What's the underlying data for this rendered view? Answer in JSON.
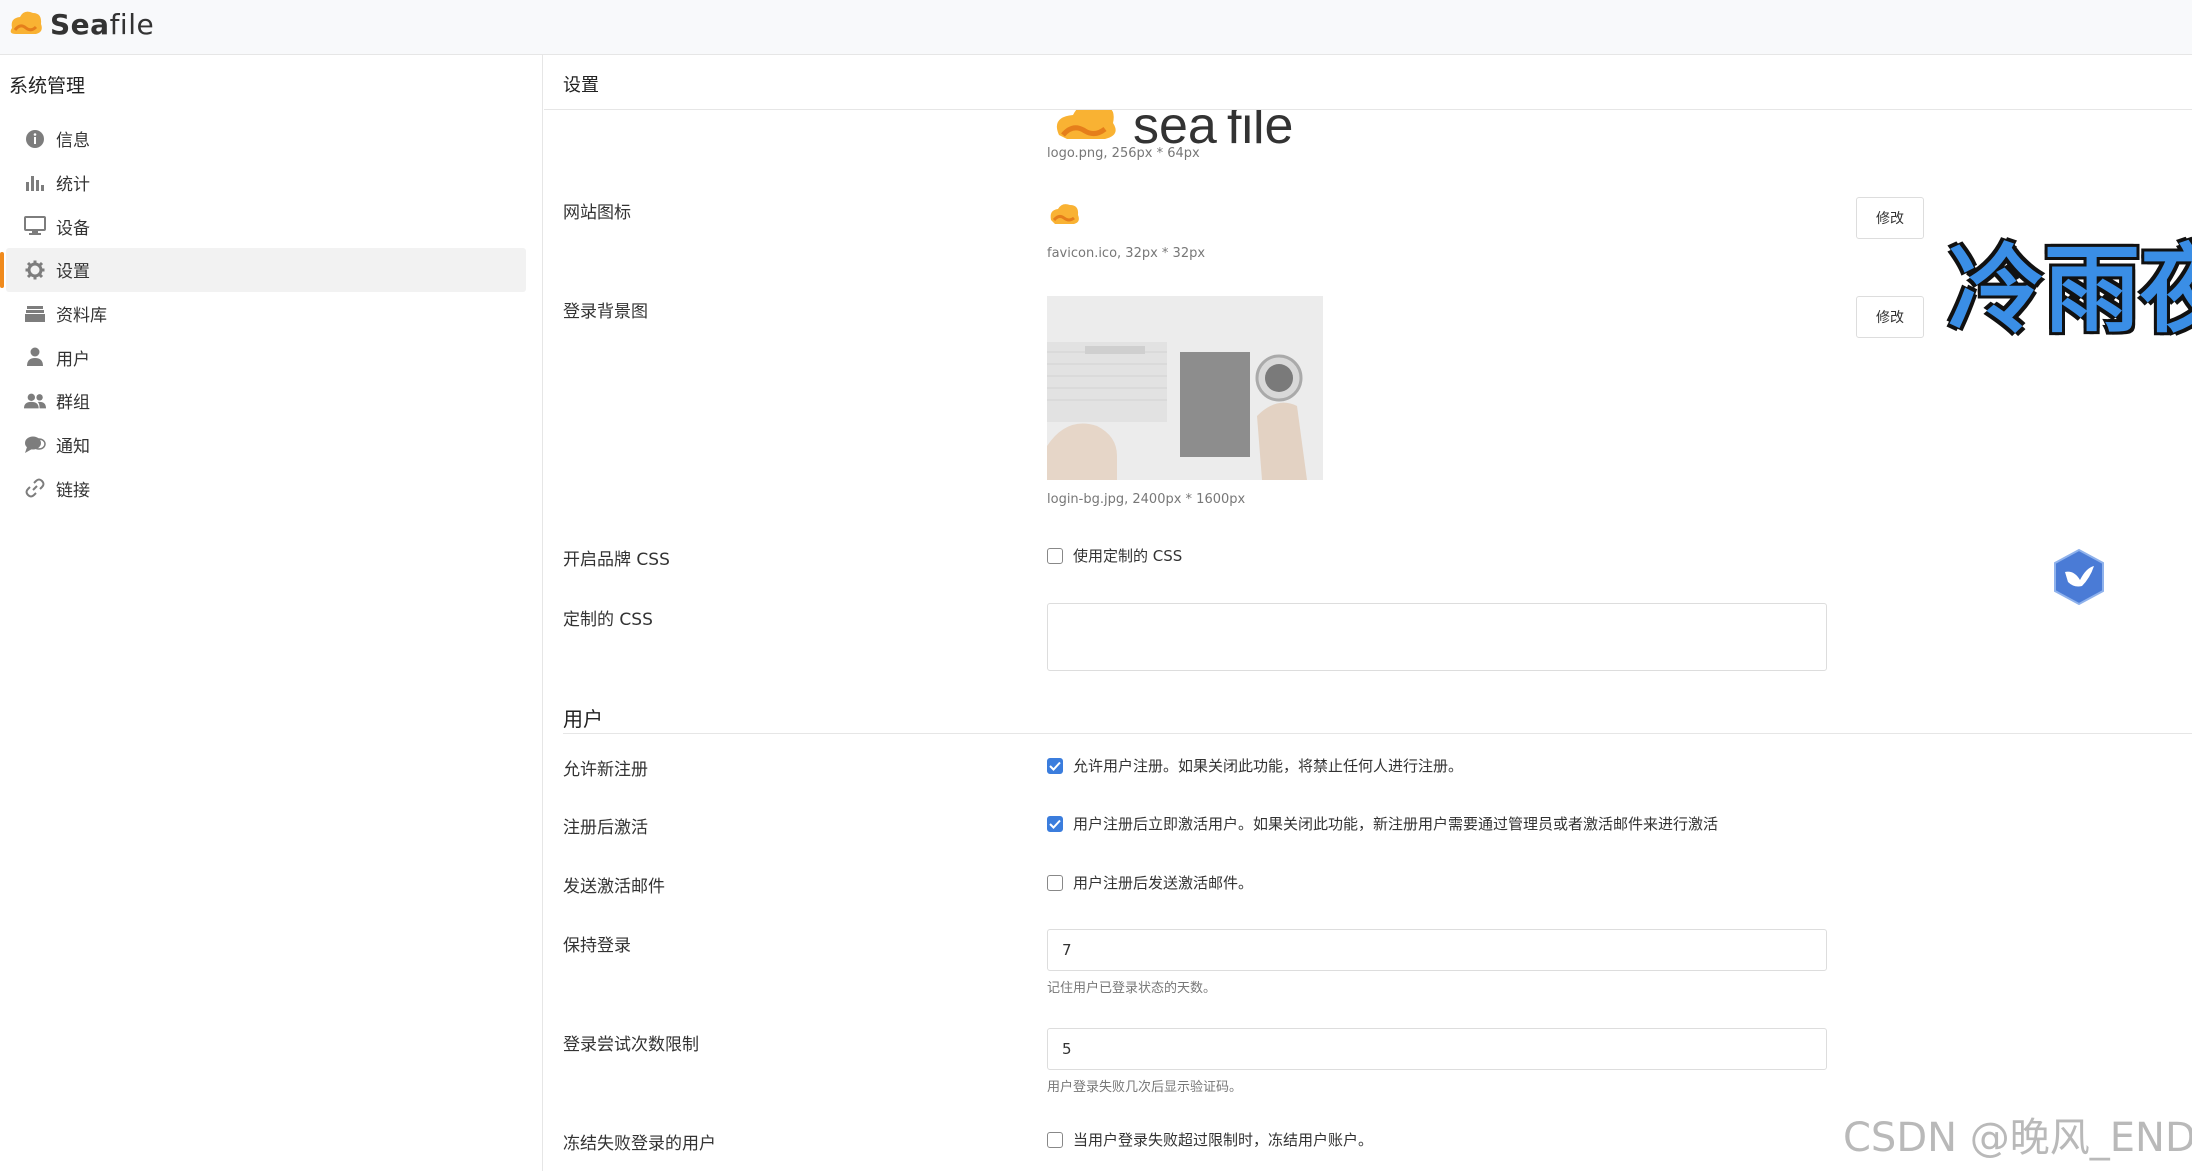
{
  "brand": {
    "name_part1": "Sea",
    "name_part2": "file"
  },
  "sidebar": {
    "title": "系统管理",
    "items": [
      {
        "label": "信息",
        "icon": "info-icon"
      },
      {
        "label": "统计",
        "icon": "bar-chart-icon"
      },
      {
        "label": "设备",
        "icon": "monitor-icon"
      },
      {
        "label": "设置",
        "icon": "gear-icon",
        "active": true
      },
      {
        "label": "资料库",
        "icon": "library-icon"
      },
      {
        "label": "用户",
        "icon": "user-icon"
      },
      {
        "label": "群组",
        "icon": "group-icon"
      },
      {
        "label": "通知",
        "icon": "chat-icon"
      },
      {
        "label": "链接",
        "icon": "link-icon"
      }
    ]
  },
  "main": {
    "title": "设置",
    "logo": {
      "hint": "logo.png, 256px * 64px"
    },
    "favicon": {
      "label": "网站图标",
      "hint": "favicon.ico, 32px * 32px",
      "button": "修改"
    },
    "login_bg": {
      "label": "登录背景图",
      "hint": "login-bg.jpg, 2400px * 1600px",
      "button": "修改"
    },
    "brand_css": {
      "label": "开启品牌 CSS",
      "checkbox_label": "使用定制的 CSS",
      "checked": false
    },
    "custom_css": {
      "label": "定制的 CSS",
      "value": ""
    },
    "users_section": {
      "title": "用户",
      "allow_register": {
        "label": "允许新注册",
        "checkbox_label": "允许用户注册。如果关闭此功能，将禁止任何人进行注册。",
        "checked": true
      },
      "activate_after_register": {
        "label": "注册后激活",
        "checkbox_label": "用户注册后立即激活用户。如果关闭此功能，新注册用户需要通过管理员或者激活邮件来进行激活",
        "checked": true
      },
      "send_activation_email": {
        "label": "发送激活邮件",
        "checkbox_label": "用户注册后发送激活邮件。",
        "checked": false
      },
      "keep_login": {
        "label": "保持登录",
        "value": "7",
        "hint": "记住用户已登录状态的天数。"
      },
      "login_attempt_limit": {
        "label": "登录尝试次数限制",
        "value": "5",
        "hint": "用户登录失败几次后显示验证码。"
      },
      "freeze_failed_user": {
        "label": "冻结失败登录的用户",
        "checkbox_label": "当用户登录失败超过限制时，冻结用户账户。",
        "checked": false
      }
    }
  },
  "overlay": {
    "text": "冷雨夜",
    "watermark": "CSDN @晚风_END"
  },
  "colors": {
    "accent": "#f08a1c",
    "checkbox": "#3b7ddd",
    "border": "#e6e6e6"
  }
}
